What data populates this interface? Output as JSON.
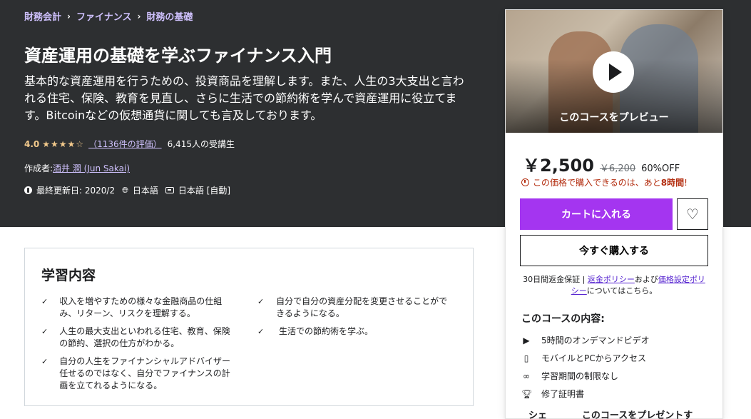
{
  "breadcrumb": [
    "財務会計",
    "ファイナンス",
    "財務の基礎"
  ],
  "course": {
    "title": "資産運用の基礎を学ぶファイナンス入門",
    "subtitle": "基本的な資産運用を行うための、投資商品を理解します。また、人生の3大支出と言われる住宅、保険、教育を見直し、さらに生活での節約術を学んで資産運用に役立てます。Bitcoinなどの仮想通貨に関しても言及しております。",
    "rating": "4.0",
    "stars": 4,
    "rating_count": "（1136件の評価）",
    "students": "6,415人の受講生",
    "author_label": "作成者:",
    "author": "酒井 潤 (Jun Sakai)",
    "updated": "最終更新日: 2020/2",
    "language": "日本語",
    "captions": "日本語 [自動]"
  },
  "sidebar": {
    "preview_label": "このコースをプレビュー",
    "price": "￥2,500",
    "original_price": "￥6,200",
    "discount": "60%OFF",
    "timer_text": "この価格で購入できるのは、あと",
    "timer_strong": "8時間",
    "timer_end": "!",
    "cart_button": "カートに入れる",
    "buy_button": "今すぐ購入する",
    "guarantee_prefix": "30日間返金保証 | ",
    "refund_policy": "返金ポリシー",
    "and": "および",
    "pricing_policy": "価格設定ポリシー",
    "guarantee_suffix": "についてはこちら。",
    "includes_title": "このコースの内容:",
    "includes": [
      {
        "icon": "video-icon",
        "text": "5時間のオンデマンドビデオ"
      },
      {
        "icon": "mobile-icon",
        "text": "モバイルとPCからアクセス"
      },
      {
        "icon": "infinity-icon",
        "text": "学習期間の制限なし"
      },
      {
        "icon": "trophy-icon",
        "text": "修了証明書"
      }
    ],
    "share": "シェア",
    "gift": "このコースをプレゼントする"
  },
  "learn": {
    "title": "学習内容",
    "left": [
      "収入を増やすための様々な金融商品の仕組み、リターン、リスクを理解する。",
      "人生の最大支出といわれる住宅、教育、保険の節約、選択の仕方がわかる。",
      "自分の人生をファイナンシャルアドバイザー任せるのではなく、自分でファイナンスの計画を立てれるようになる。"
    ],
    "right": [
      "自分で自分の資産分配を変更させることができるようになる。",
      "生活での節約術を学ぶ。"
    ]
  },
  "colors": {
    "hero_bg": "#2d2f31",
    "accent": "#a435f0",
    "link": "#cec0fc",
    "star": "#f3ca8c",
    "alert": "#b32d0f"
  }
}
